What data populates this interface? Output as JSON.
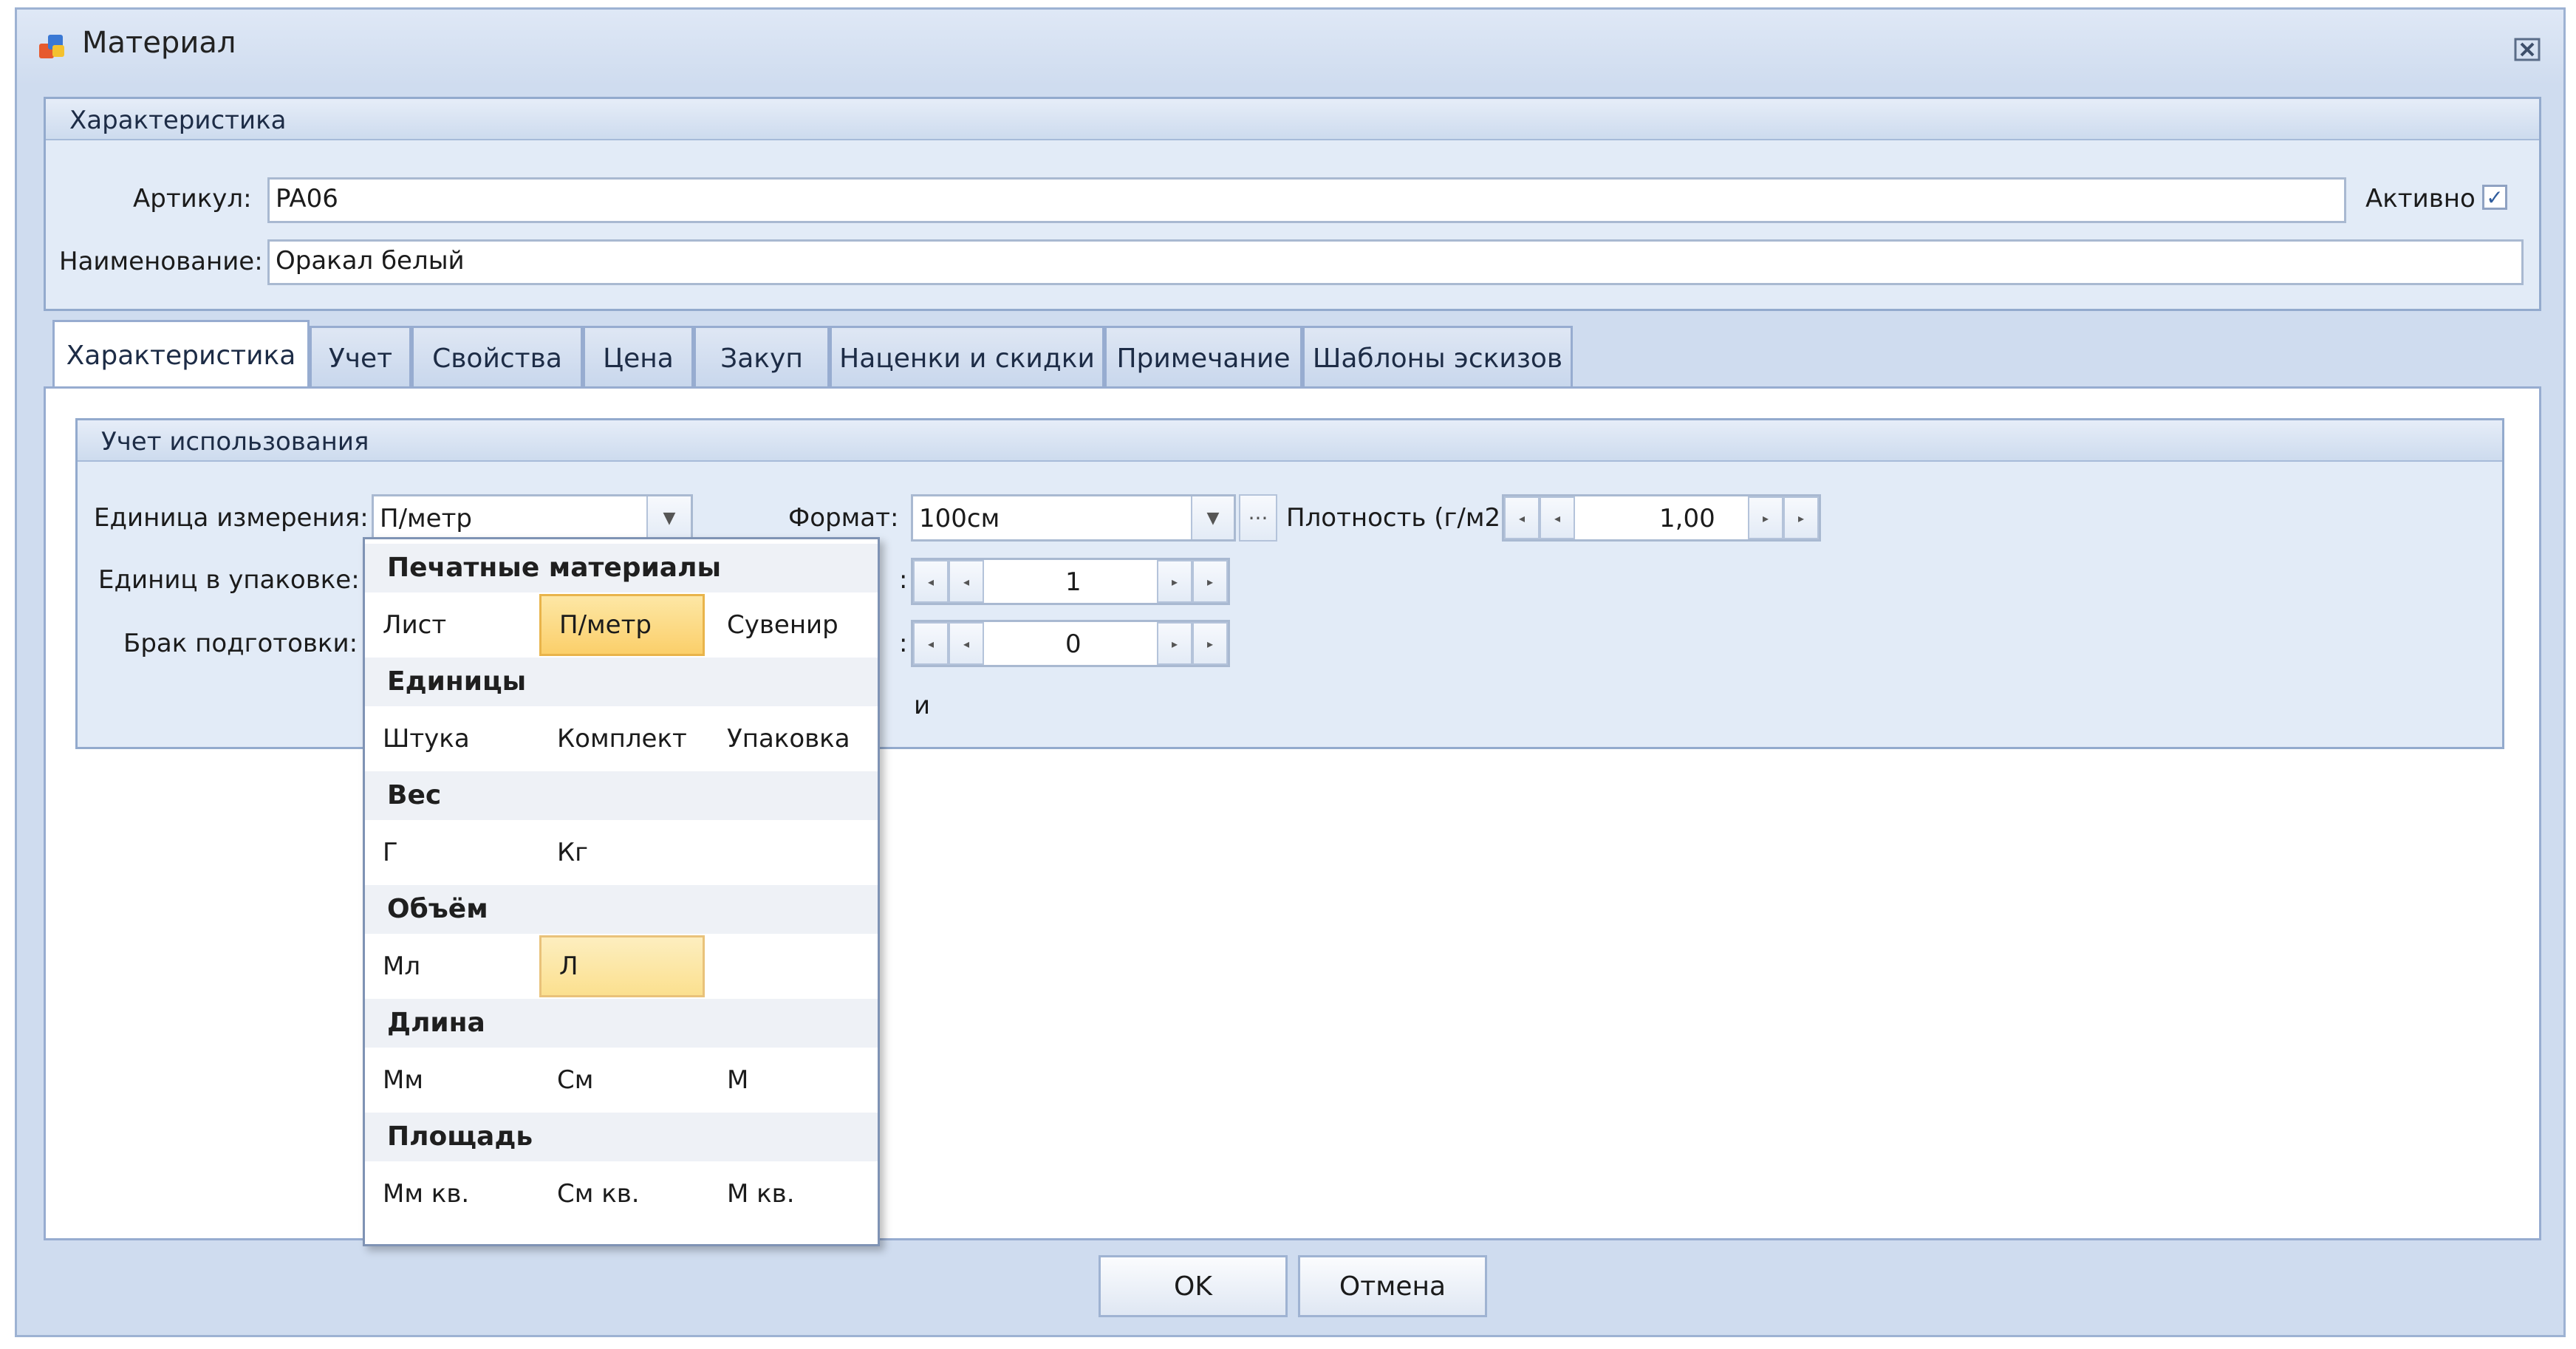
{
  "window": {
    "title": "Материал"
  },
  "characteristics_group": {
    "title": "Характеристика",
    "article_label": "Артикул:",
    "article_value": "PA06",
    "active_label": "Активно",
    "active_checked": true,
    "name_label": "Наименование:",
    "name_value": "Оракал белый"
  },
  "tabs": [
    {
      "label": "Характеристика",
      "active": true
    },
    {
      "label": "Учет"
    },
    {
      "label": "Свойства"
    },
    {
      "label": "Цена"
    },
    {
      "label": "Закуп"
    },
    {
      "label": "Наценки и скидки"
    },
    {
      "label": "Примечание"
    },
    {
      "label": "Шаблоны эскизов"
    }
  ],
  "usage_group": {
    "title": "Учет использования",
    "unit_label": "Единица измерения:",
    "unit_value": "П/метр",
    "format_label": "Формат:",
    "format_value": "100см",
    "density_label": "Плотность (г/м2):",
    "density_value": "1,00",
    "units_per_pack_label": "Единиц в упаковке:",
    "units_per_pack_value": "1",
    "waste_label": "Брак подготовки:",
    "waste_value": "0",
    "colon": ":",
    "partial_text": "и"
  },
  "unit_dropdown": {
    "categories": [
      {
        "name": "Печатные материалы",
        "items": [
          "Лист",
          "П/метр",
          "Сувенир"
        ]
      },
      {
        "name": "Единицы",
        "items": [
          "Штука",
          "Комплект",
          "Упаковка"
        ]
      },
      {
        "name": "Вес",
        "items": [
          "Г",
          "Кг"
        ]
      },
      {
        "name": "Объём",
        "items": [
          "Мл",
          "Л"
        ]
      },
      {
        "name": "Длина",
        "items": [
          "Мм",
          "См",
          "М"
        ]
      },
      {
        "name": "Площадь",
        "items": [
          "Мм кв.",
          "См кв.",
          "М кв."
        ]
      }
    ],
    "selected": "П/метр",
    "hovered": "Л"
  },
  "buttons": {
    "ok": "OK",
    "cancel": "Отмена"
  },
  "icons": {
    "window_icon": "app-icon",
    "close": "close-icon",
    "dropdown": "chevron-down-icon",
    "ellipsis": "ellipsis-icon"
  }
}
